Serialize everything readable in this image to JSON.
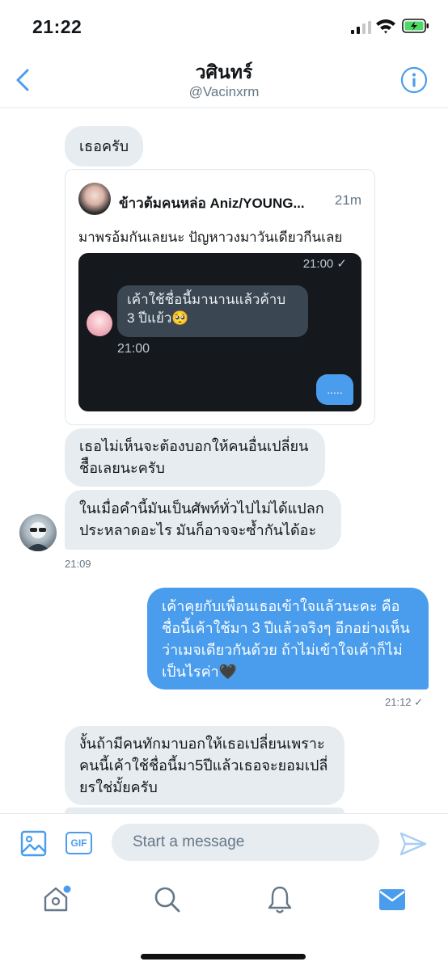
{
  "status_bar": {
    "time": "21:22",
    "signal_icon": "cellular-signal-icon",
    "wifi_icon": "wifi-icon",
    "battery_icon": "battery-charging-icon"
  },
  "header": {
    "name": "วศินทร์",
    "handle": "@Vacinxrm",
    "back_icon": "chevron-left-icon",
    "info_icon": "info-icon"
  },
  "messages": [
    {
      "text": "เธอครับ",
      "direction": "incoming"
    },
    {
      "type": "quoted_tweet",
      "author": "ข้าวต้มคนหล่อ Aniz/YOUNG...",
      "time": "21m",
      "text": "มาพรอ้มกันเลยนะ ปัญหาวงมาวันเดียวกีนเลย",
      "image": {
        "time": "21:00 ✓",
        "bubble_line1": "เค้าใช้ชื่อนี้มานานแล้วค้าบ",
        "bubble_line2": "3 ปีแย้ว🥺",
        "stamp": "21:00",
        "out_bubble": "....."
      }
    },
    {
      "lines": [
        "เธอไม่เห็นจะต้องบอกให้คนอื่นเปลี่ยน",
        "ชืือเลยนะครับ"
      ],
      "direction": "incoming"
    },
    {
      "lines": [
        "ในเมื่อคำนี้มันเป็นศัพท์ทั่วไปไม่ได้แปลก",
        "ประหลาดอะไร มันก็อาจจะซ้ำกันได้อะ"
      ],
      "direction": "incoming",
      "stamp": "21:09"
    },
    {
      "lines": [
        "เค้าคุยกับเพื่อนเธอเข้าใจแล้วนะคะ คือ",
        "ชื่อนี้เค้าใช้มา 3 ปีแล้วจริงๆ อีกอย่างเห็น",
        "ว่าเมจเดียวกันด้วย ถ้าไม่เข้าใจเค้าก็ไม่",
        "เป็นไรค่า🖤"
      ],
      "direction": "outgoing",
      "stamp": "21:12 ✓"
    },
    {
      "lines": [
        "งั้นถ้ามีคนทักมาบอกให้เธอเปลี่ยนเพราะ",
        "คนนี้เค้าใช้ชื่อนี้มา5ปีแล้วเธอจะยอมเปลี่",
        "ยรใช่มั้ยครับ"
      ],
      "direction": "incoming"
    }
  ],
  "composer": {
    "placeholder": "Start a message",
    "gif_label": "GIF",
    "image_icon": "image-icon",
    "send_icon": "send-icon"
  },
  "tabbar": {
    "items": [
      "home-icon",
      "search-icon",
      "notifications-icon",
      "messages-icon"
    ],
    "active": "messages-icon",
    "home_has_dot": true
  },
  "colors": {
    "accent": "#4a9ded",
    "bubble_incoming": "#e6ecf0",
    "secondary_text": "#657786"
  }
}
